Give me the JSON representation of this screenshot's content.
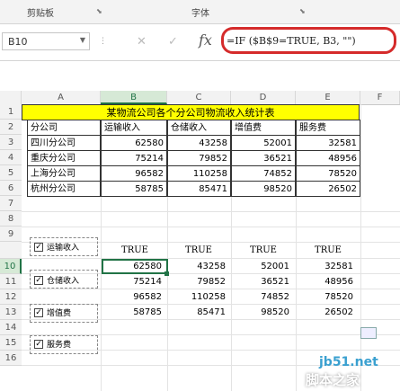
{
  "ribbon": {
    "clipboard_group": "剪贴板",
    "font_group": "字体"
  },
  "formula_bar": {
    "name_box": "B10",
    "fx": "fx",
    "formula": "=IF ($B$9=TRUE, B3, \"\")"
  },
  "columns": [
    "A",
    "B",
    "C",
    "D",
    "E",
    "F"
  ],
  "rows": [
    "1",
    "2",
    "3",
    "4",
    "5",
    "6",
    "7",
    "8",
    "9",
    "10",
    "11",
    "12",
    "13",
    "14",
    "15",
    "16"
  ],
  "table": {
    "title": "某物流公司各个分公司物流收入统计表",
    "headers": [
      "分公司",
      "运输收入",
      "仓储收入",
      "增值费",
      "服务费"
    ],
    "rows": [
      [
        "四川分公司",
        "62580",
        "43258",
        "52001",
        "32581"
      ],
      [
        "重庆分公司",
        "75214",
        "79852",
        "36521",
        "48956"
      ],
      [
        "上海分公司",
        "96582",
        "110258",
        "74852",
        "78520"
      ],
      [
        "杭州分公司",
        "58785",
        "85471",
        "98520",
        "26502"
      ]
    ]
  },
  "checkboxes": [
    {
      "label": "运输收入",
      "checked": "✓"
    },
    {
      "label": "仓储收入",
      "checked": "✓"
    },
    {
      "label": "增值费",
      "checked": "✓"
    },
    {
      "label": "服务费",
      "checked": "✓"
    }
  ],
  "flags": [
    "TRUE",
    "TRUE",
    "TRUE",
    "TRUE"
  ],
  "result": [
    [
      "62580",
      "43258",
      "52001",
      "32581"
    ],
    [
      "75214",
      "79852",
      "36521",
      "48956"
    ],
    [
      "96582",
      "110258",
      "74852",
      "78520"
    ],
    [
      "58785",
      "85471",
      "98520",
      "26502"
    ]
  ],
  "watermark": {
    "line1": "jb51.net",
    "line2": "脚本之家"
  },
  "colors": {
    "accent": "#217346",
    "title_fill": "#ffff00",
    "highlight_oval": "#d52b2b"
  }
}
